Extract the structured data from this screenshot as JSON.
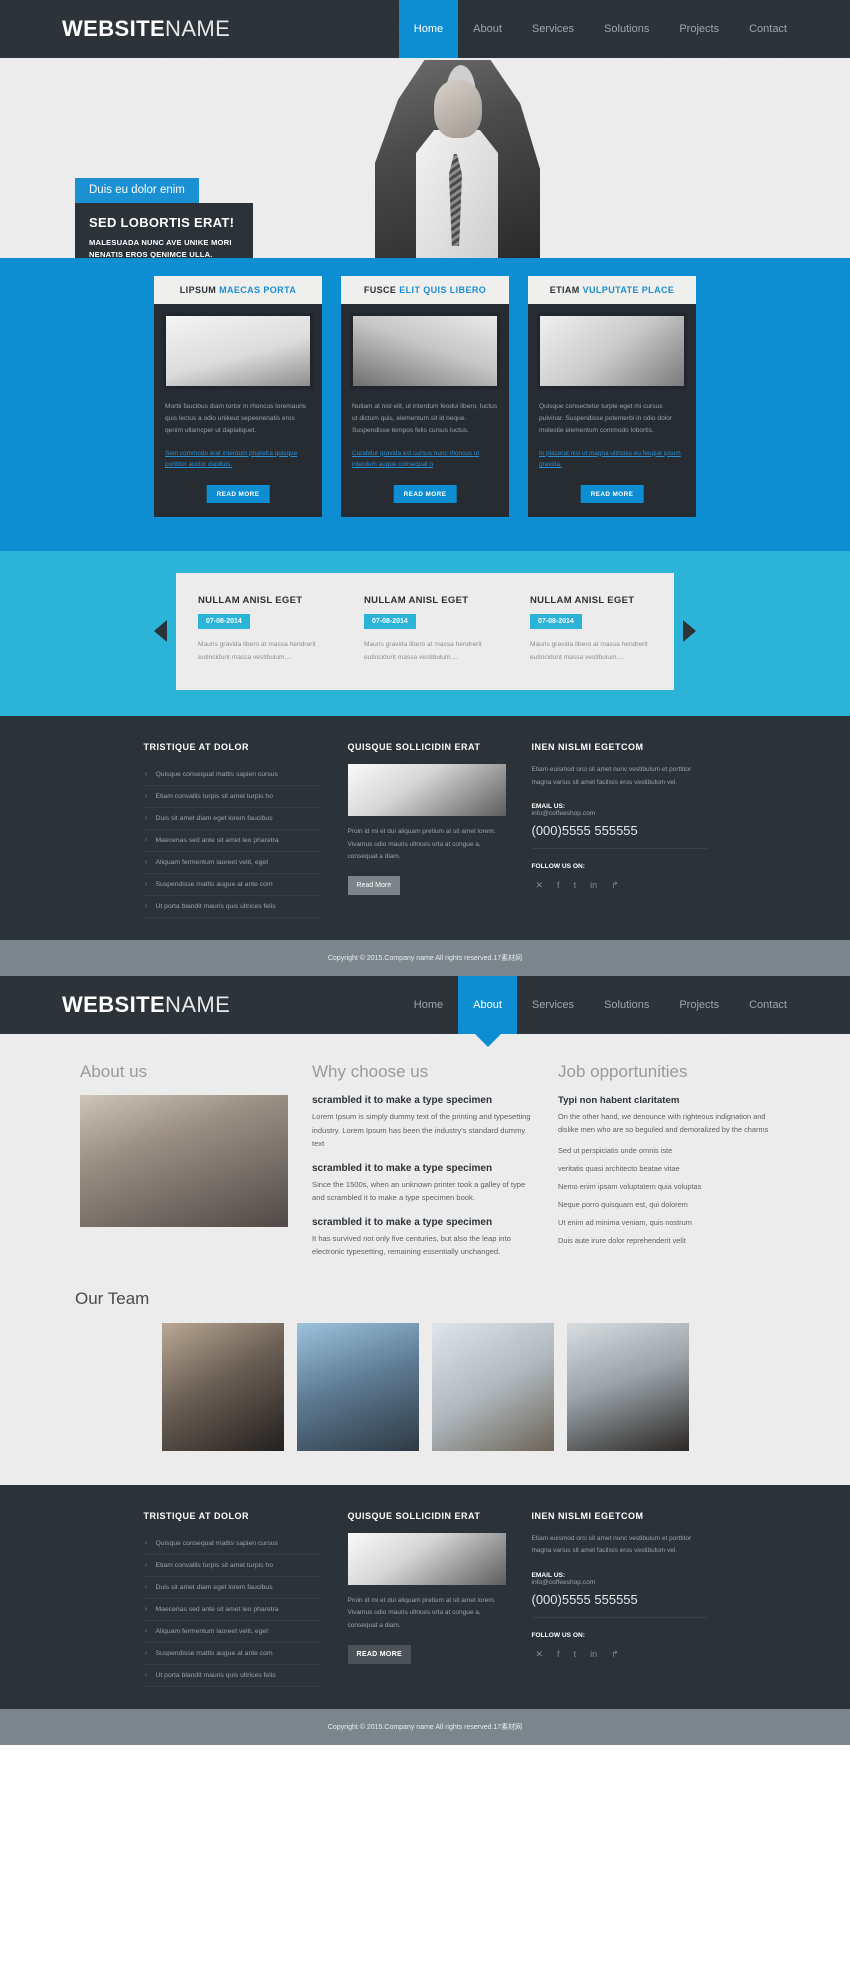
{
  "brand": {
    "bold": "WEBSITE",
    "light": "NAME"
  },
  "nav": {
    "home": "Home",
    "about": "About",
    "services": "Services",
    "solutions": "Solutions",
    "projects": "Projects",
    "contact": "Contact"
  },
  "hero": {
    "badge": "Duis eu dolor enim",
    "title": "SED LOBORTIS ERAT!",
    "sub_line1": "MALESUADA NUNC AVE UNIKE MORI",
    "sub_line2": "NENATIS EROS QENIMCE ULLA."
  },
  "features": {
    "cards": [
      {
        "head_main": "LIPSUM",
        "head_accent": "MAECAS PORTA",
        "text": "Morbi faucibus diam tortor in rhoncus loremauris quis lectus a odio unikeut sepeenenatis eros qenim ullamcper ut dapialiquet.",
        "link": "Sem commodo erat interdum pharetra quisque porttitor auctor dapibus.",
        "button": "READ MORE"
      },
      {
        "head_main": "FUSCE",
        "head_accent": "ELIT QUIS LIBERO",
        "text": "Nullam at nisl elit, ut interdum feodui libero, luctus ut dictum quis, elementum sit id neque. Suspendisse tempos felis cursus luctus.",
        "link": "Curabitur gravida est cursus nunc rhoncus ut interdum augue consequat n",
        "button": "READ MORE"
      },
      {
        "head_main": "ETIAM",
        "head_accent": "VULPUTATE PLACE",
        "text": "Quisque consectetur turpie eget mi cursus pulvinar. Suspendisse potenterbi in odio dolor molestie elementum commodo lobortis.",
        "link": "In placerat nisl ut magna ultricies eu feugiat ipsum gravida.",
        "button": "READ MORE"
      }
    ]
  },
  "carousel": {
    "prev": "previous",
    "next": "next",
    "items": [
      {
        "title": "NULLAM ANISL EGET",
        "date": "07-08-2014",
        "text": "Mauris gravida libero at massa hendrerit eutincidunt massa vestibulum...."
      },
      {
        "title": "NULLAM ANISL EGET",
        "date": "07-08-2014",
        "text": "Mauris gravida libero at massa hendrerit eutincidunt massa vestibulum...."
      },
      {
        "title": "NULLAM ANISL EGET",
        "date": "07-08-2014",
        "text": "Mauris gravida libero at massa hendrerit eutincidunt massa vestibulum...."
      }
    ]
  },
  "footer": {
    "col1_title": "TRISTIQUE AT DOLOR",
    "links": [
      "Quisque consequat mattis sapien cursus",
      "Etiam convallis turpis sit amet turpis ho",
      "Duis sit amet diam eget lorem faucibus",
      "Maecenas sed ante sit amet leo pharetra",
      "Aliquam fermentum laoreet velit, eget",
      "Suspendisse mattis augue at ante com",
      "Ut porta blandit mauris quis ultrices felis"
    ],
    "col2_title": "QUISQUE SOLLICIDIN ERAT",
    "col2_text": "Proin id mi et dui aliquam pretium at sit amet lorem. Vivamus odio mauris ultrices orta at congue a, consequat a diam.",
    "col2_button": "Read More",
    "col2_button_alt": "READ MORE",
    "col3_title": "INEN NISLMI EGETCOM",
    "col3_text": "Etiam euismod orci sit amet nunc vestibulum et porttitor magna varius sit amet facilisis eros vestibulum vel.",
    "email_label": "EMAIL US:",
    "email": "info@coffeeshop.com",
    "phone": "(000)5555 555555",
    "follow_label": "FOLLOW US ON:",
    "social": [
      "✕",
      "f",
      "t",
      "in",
      "↱"
    ]
  },
  "copyright": "Copyright © 2015.Company name All rights reserved.17素材网",
  "about": {
    "col1_title": "About us",
    "col2_title": "Why choose us",
    "col3_title": "Job opportunities",
    "why_blocks": [
      {
        "h": "scrambled it to make a type specimen",
        "p": "Lorem Ipsum is simply dummy text of the printing and typesetting industry. Lorem Ipsum has been the industry's standard dummy text"
      },
      {
        "h": "scrambled it to make a type specimen",
        "p": "Since the 1500s, when an unknown printer took a galley of type and scrambled it to make a type specimen book."
      },
      {
        "h": "scrambled it to make a type specimen",
        "p": "It has survived not only five centuries, but also the leap into electronic typesetting, remaining essentially unchanged."
      }
    ],
    "job_h": "Typi non habent claritatem",
    "job_p": "On the other hand, we denounce with righteous indignation and dislike men who are so beguiled and demoralized by the charms",
    "job_items": [
      "Sed ut perspiciatis unde omnis iste",
      "veritatis quasi architecto beatae vitae",
      "Nemo enim ipsam voluptatem quia voluptas",
      "Neque porro quisquam est, qui dolorem",
      "Ut enim ad minima veniam, quis nostrum",
      "Duis aute irure dolor reprehenderit velit"
    ],
    "team_title": "Our Team"
  }
}
